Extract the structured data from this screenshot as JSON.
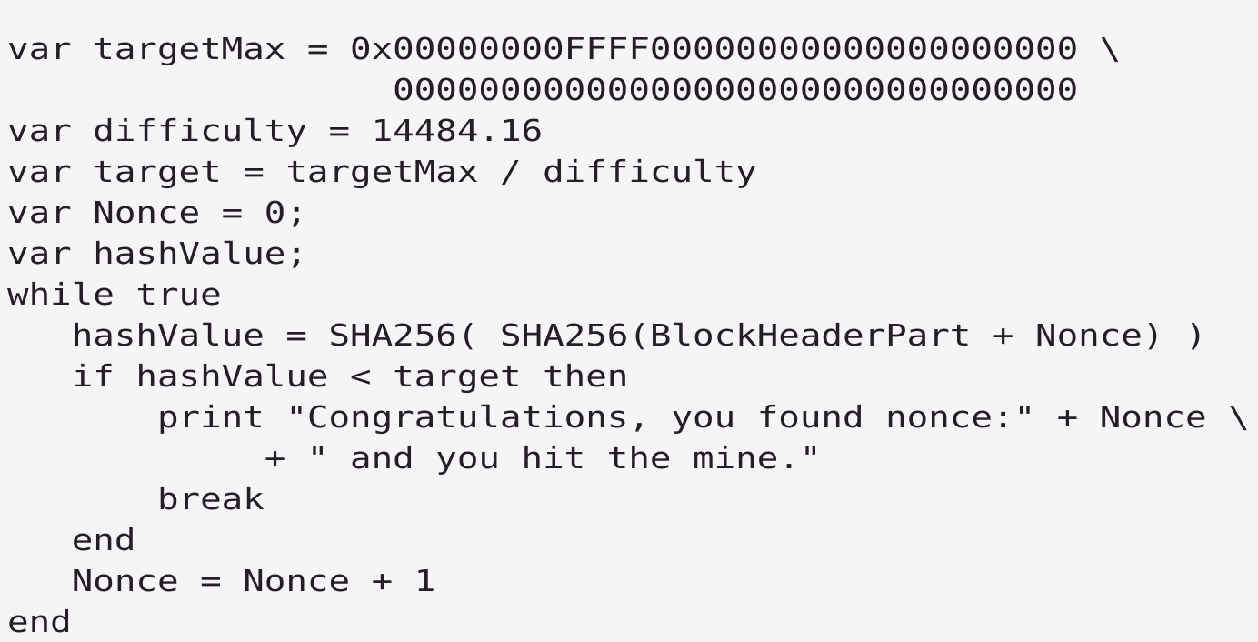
{
  "snippet": {
    "language": "pseudocode",
    "background_color": "#f7f4f7",
    "text_color": "#241f26",
    "lines": [
      "var targetMax = 0x00000000FFFF00000000000000000000 \\",
      "                  00000000000000000000000000000000",
      "var difficulty = 14484.16",
      "var target = targetMax / difficulty",
      "var Nonce = 0;",
      "var hashValue;",
      "while true",
      "   hashValue = SHA256( SHA256(BlockHeaderPart + Nonce) )",
      "   if hashValue < target then",
      "       print \"Congratulations, you found nonce:\" + Nonce \\",
      "            + \" and you hit the mine.\"",
      "       break",
      "   end",
      "   Nonce = Nonce + 1",
      "end"
    ]
  }
}
